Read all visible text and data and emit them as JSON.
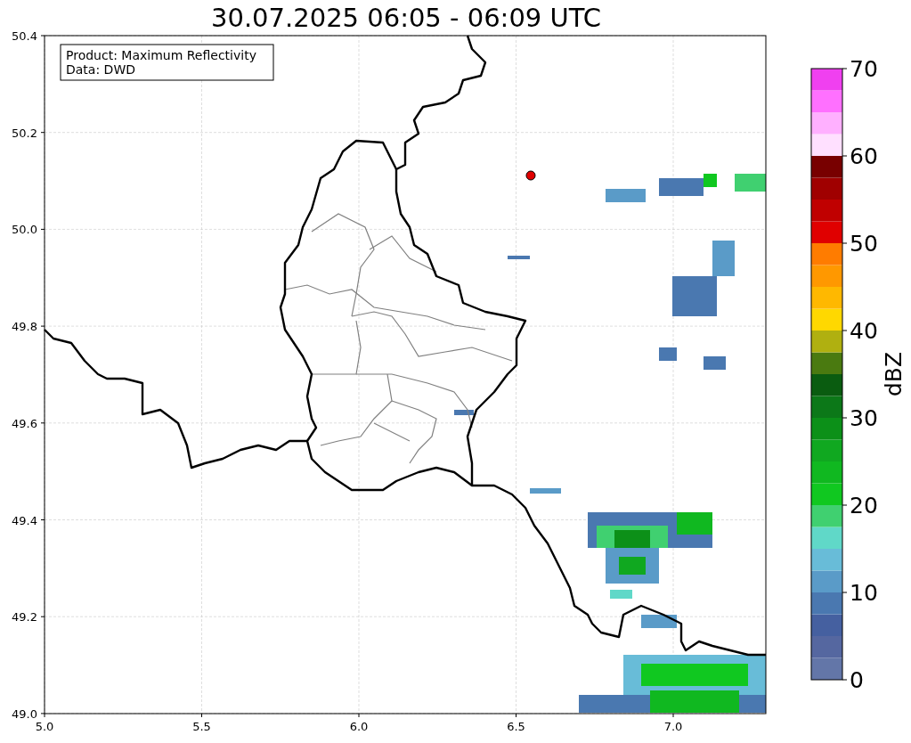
{
  "title": "30.07.2025 06:05 - 06:09 UTC",
  "info_box": [
    "Product: Maximum Reflectivity",
    "Data: DWD"
  ],
  "x_ticks": [
    "5.0",
    "5.5",
    "6.0",
    "6.5",
    "7.0"
  ],
  "y_ticks": [
    "50.4",
    "50.2",
    "50.0",
    "49.8",
    "49.6",
    "49.4",
    "49.2",
    "49.0"
  ],
  "colorbar": {
    "label": "dBZ",
    "ticks": [
      "70",
      "60",
      "50",
      "40",
      "30",
      "20",
      "10",
      "0"
    ],
    "segments": [
      {
        "color": "#6376a8"
      },
      {
        "color": "#5567a0"
      },
      {
        "color": "#4560a0"
      },
      {
        "color": "#4a78b0"
      },
      {
        "color": "#5a9bc8"
      },
      {
        "color": "#68bcd8"
      },
      {
        "color": "#60d8c8"
      },
      {
        "color": "#40d070"
      },
      {
        "color": "#10c820"
      },
      {
        "color": "#10b820"
      },
      {
        "color": "#10a820"
      },
      {
        "color": "#0c9018"
      },
      {
        "color": "#0c7818"
      },
      {
        "color": "#0a5c10"
      },
      {
        "color": "#4a7a10"
      },
      {
        "color": "#b0b010"
      },
      {
        "color": "#ffd800"
      },
      {
        "color": "#ffb800"
      },
      {
        "color": "#ff9800"
      },
      {
        "color": "#ff7c00"
      },
      {
        "color": "#e00000"
      },
      {
        "color": "#c00000"
      },
      {
        "color": "#a00000"
      },
      {
        "color": "#780000"
      },
      {
        "color": "#ffe0ff"
      },
      {
        "color": "#ffb0ff"
      },
      {
        "color": "#ff70ff"
      },
      {
        "color": "#f040f0"
      }
    ]
  }
}
